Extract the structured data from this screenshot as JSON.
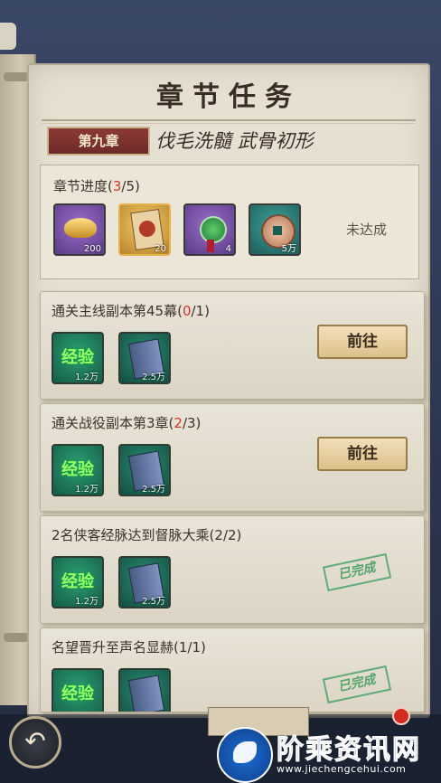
{
  "title": "章节任务",
  "chapter": {
    "tag": "第九章",
    "name": "伐毛洗髓 武骨初形"
  },
  "progress": {
    "label_prefix": "章节进度(",
    "current": "3",
    "label_suffix": "/5)",
    "status": "未达成",
    "items": [
      {
        "icon": "gold-ingot-icon",
        "qty": "200",
        "rarity": "purple"
      },
      {
        "icon": "card-icon",
        "qty": "20",
        "rarity": "gold"
      },
      {
        "icon": "jade-pendant-icon",
        "qty": "4",
        "rarity": "purple"
      },
      {
        "icon": "copper-coin-icon",
        "qty": "5万",
        "rarity": "teal"
      }
    ]
  },
  "tasks": [
    {
      "title_prefix": "通关主线副本第45幕(",
      "current": "0",
      "title_suffix": "/1)",
      "current_red": true,
      "rewards": [
        {
          "label": "经验",
          "qty": "1.2万"
        },
        {
          "label": "",
          "qty": "2.5万"
        }
      ],
      "action": "前往"
    },
    {
      "title_prefix": "通关战役副本第3章(",
      "current": "2",
      "title_suffix": "/3)",
      "current_red": true,
      "rewards": [
        {
          "label": "经验",
          "qty": "1.2万"
        },
        {
          "label": "",
          "qty": "2.5万"
        }
      ],
      "action": "前往"
    },
    {
      "title_prefix": "2名侠客经脉达到督脉大乘(",
      "current": "2",
      "title_suffix": "/2)",
      "current_red": false,
      "rewards": [
        {
          "label": "经验",
          "qty": "1.2万"
        },
        {
          "label": "",
          "qty": "2.5万"
        }
      ],
      "status": "已完成"
    },
    {
      "title_prefix": "名望晋升至声名显赫(",
      "current": "1",
      "title_suffix": "/1)",
      "current_red": false,
      "rewards": [
        {
          "label": "经验",
          "qty": ""
        },
        {
          "label": "",
          "qty": ""
        }
      ],
      "status": "已完成"
    }
  ],
  "watermark": {
    "name": "阶乘资讯网",
    "url": "www.jiechengcehui.com"
  }
}
